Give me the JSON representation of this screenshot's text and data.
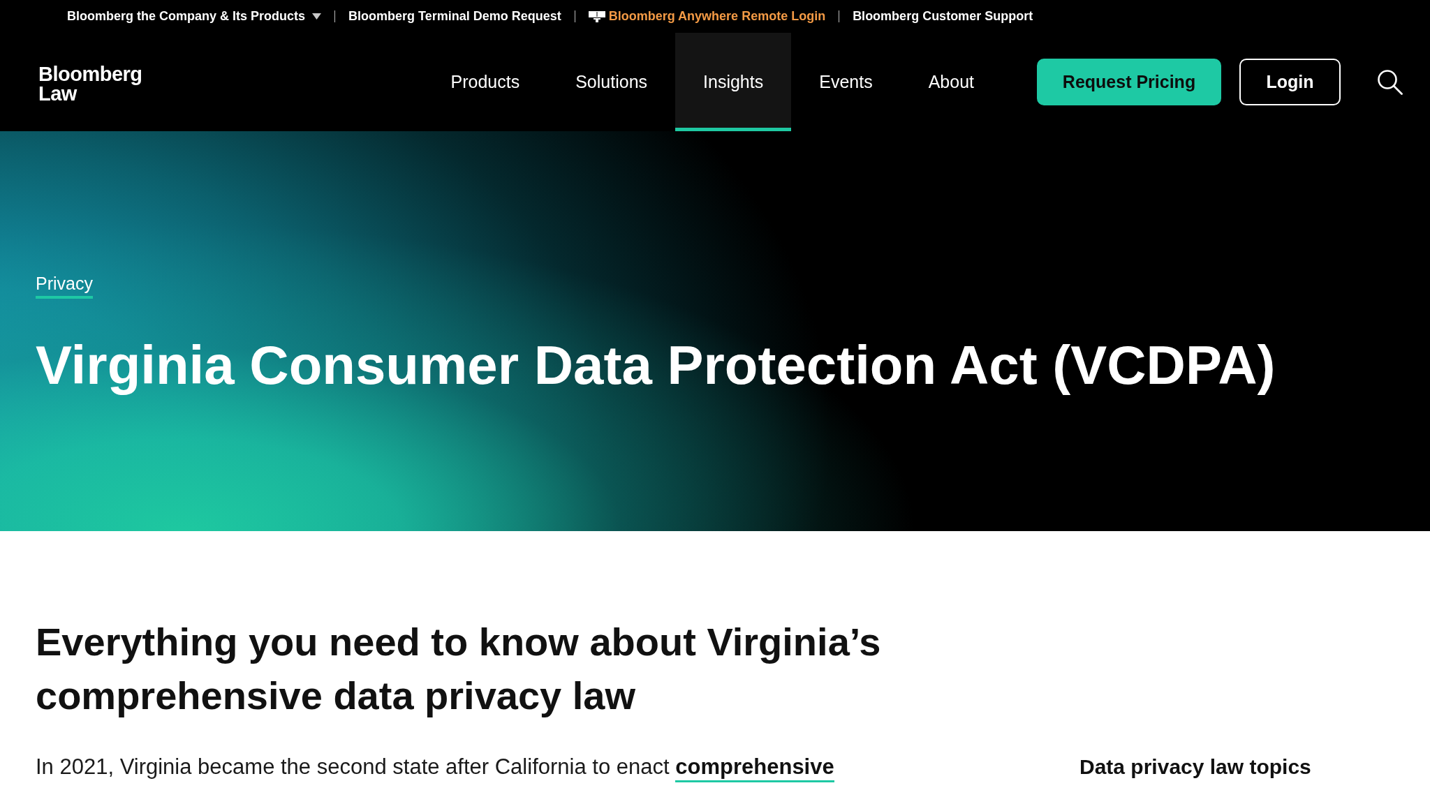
{
  "utility_bar": {
    "links": [
      {
        "label": "Bloomberg the Company & Its Products",
        "kind": "dropdown"
      },
      {
        "label": "Bloomberg Terminal Demo Request",
        "kind": "link"
      },
      {
        "label": "Bloomberg Anywhere Remote Login",
        "kind": "terminal"
      },
      {
        "label": "Bloomberg Customer Support",
        "kind": "link"
      }
    ]
  },
  "header": {
    "logo": "Bloomberg Law",
    "nav": [
      {
        "label": "Products",
        "selected": false
      },
      {
        "label": "Solutions",
        "selected": false
      },
      {
        "label": "Insights",
        "selected": true
      },
      {
        "label": "Events",
        "selected": false
      },
      {
        "label": "About",
        "selected": false
      }
    ],
    "actions": [
      {
        "label": "Request Pricing",
        "kind": "primary"
      },
      {
        "label": "Login",
        "kind": "outline"
      }
    ]
  },
  "hero": {
    "category": "Privacy",
    "title": "Virginia Consumer Data Protection Act (VCDPA)"
  },
  "article": {
    "heading": "Everything you need to know about Virginia’s comprehensive data privacy law",
    "intro": {
      "text": "In 2021, Virginia became the second state after California to enact",
      "link": "comprehensive"
    }
  },
  "sidebar": {
    "heading": "Data privacy law topics"
  }
}
